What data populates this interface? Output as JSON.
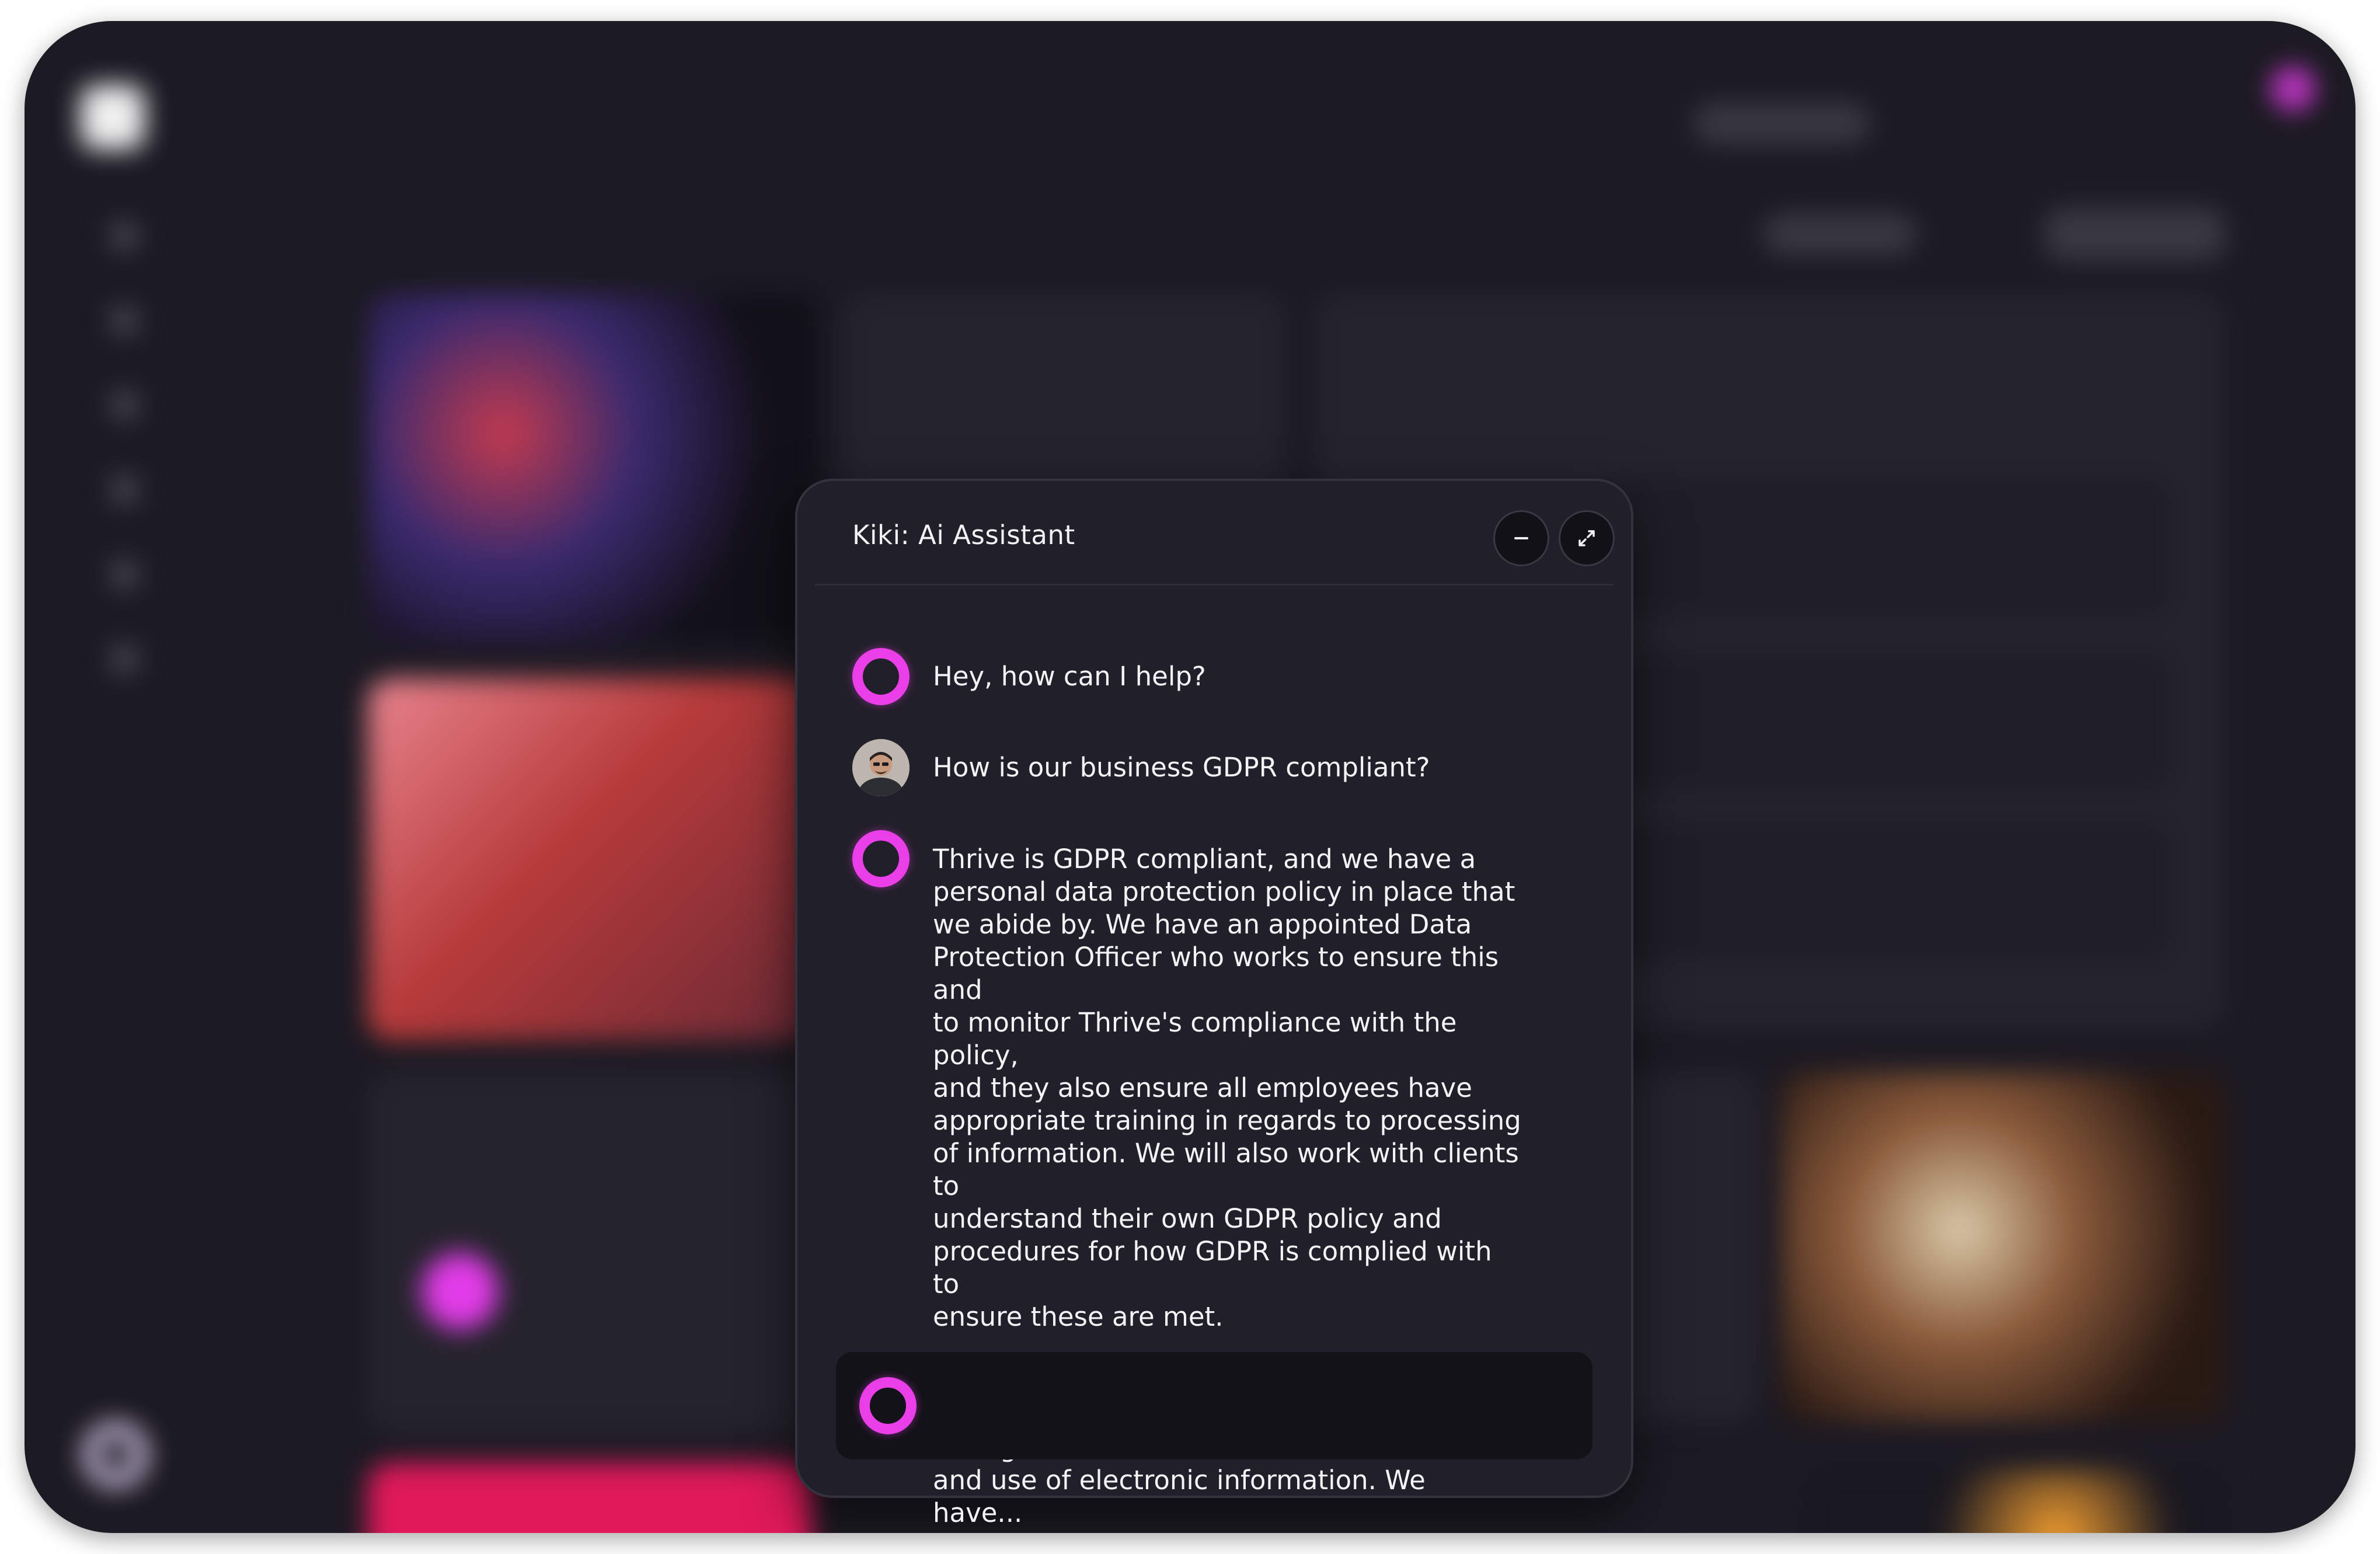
{
  "assistant": {
    "title": "Kiki: Ai Assistant",
    "minimize_icon": "minus-icon",
    "expand_icon": "expand-arrows-icon"
  },
  "messages": [
    {
      "sender": "assistant",
      "icon": "kiki-ring-icon",
      "text": "Hey, how can I help?"
    },
    {
      "sender": "user",
      "icon": "user-avatar",
      "text": "How is our business GDPR compliant?"
    },
    {
      "sender": "assistant",
      "icon": "kiki-ring-icon",
      "text": "Thrive is GDPR compliant, and we have a\npersonal data protection policy in place that\nwe abide by. We have an appointed Data\nProtection Officer who works to ensure this and\nto monitor Thrive's compliance with the policy,\nand they also ensure all employees have\nappropriate training in regards to processing\nof information. We will also work with clients to\nunderstand their own GDPR policy and\nprocedures for how GDPR is complied with to\nensure these are met.\n\nThrive complies with the Data Protection Act\nand all other relevant laws governing storage\nand use of electronic information. We have..."
    }
  ],
  "input": {
    "placeholder": "",
    "value": ""
  },
  "colors": {
    "accent": "#ea3fe8",
    "panel": "#211f29",
    "background": "#1c1a23"
  }
}
